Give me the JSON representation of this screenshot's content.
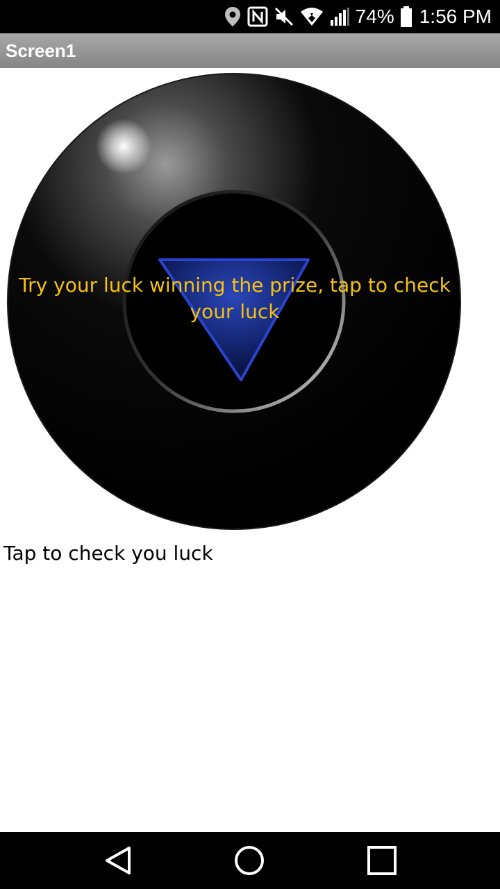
{
  "status_bar": {
    "battery_percent": "74%",
    "time": "1:56 PM",
    "icons": [
      "location-icon",
      "nfc-icon",
      "mute-icon",
      "wifi-icon",
      "signal-icon",
      "battery-icon"
    ]
  },
  "app": {
    "title": "Screen1"
  },
  "ball": {
    "message": "Try your luck winning the prize, tap to check your luck",
    "colors": {
      "body": "#000000",
      "triangle": "#1a2f8f",
      "triangle_border": "#2a44d0",
      "text": "#f5c212"
    }
  },
  "hint": {
    "label": "Tap to check you luck"
  },
  "nav_bar": {
    "icons": [
      "back-icon",
      "home-icon",
      "recents-icon"
    ]
  }
}
